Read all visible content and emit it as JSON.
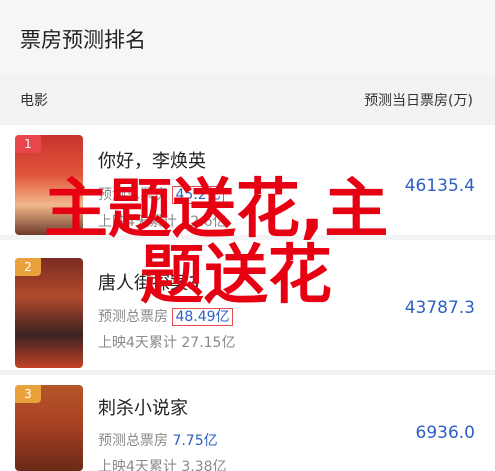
{
  "header": {
    "title": "票房预测排名"
  },
  "columns": {
    "left": "电影",
    "right": "预测当日票房(万)"
  },
  "movies": [
    {
      "rank": "1",
      "title": "你好，李焕英",
      "predicted_total_label": "预测总票房",
      "predicted_total_value": "45.2亿",
      "cumulative_label": "上映4天累计",
      "cumulative_value": "12.6亿",
      "daily_value": "46135.4"
    },
    {
      "rank": "2",
      "title": "唐人街探案3",
      "predicted_total_label": "预测总票房",
      "predicted_total_value": "48.49亿",
      "cumulative_label": "上映4天累计",
      "cumulative_value": "27.15亿",
      "daily_value": "43787.3"
    },
    {
      "rank": "3",
      "title": "刺杀小说家",
      "predicted_total_label": "预测总票房",
      "predicted_total_value": "7.75亿",
      "cumulative_label": "上映4天累计",
      "cumulative_value": "3.38亿",
      "daily_value": "6936.0"
    }
  ],
  "overlay": {
    "line1": "主题送花,主",
    "line2": "题送花"
  }
}
